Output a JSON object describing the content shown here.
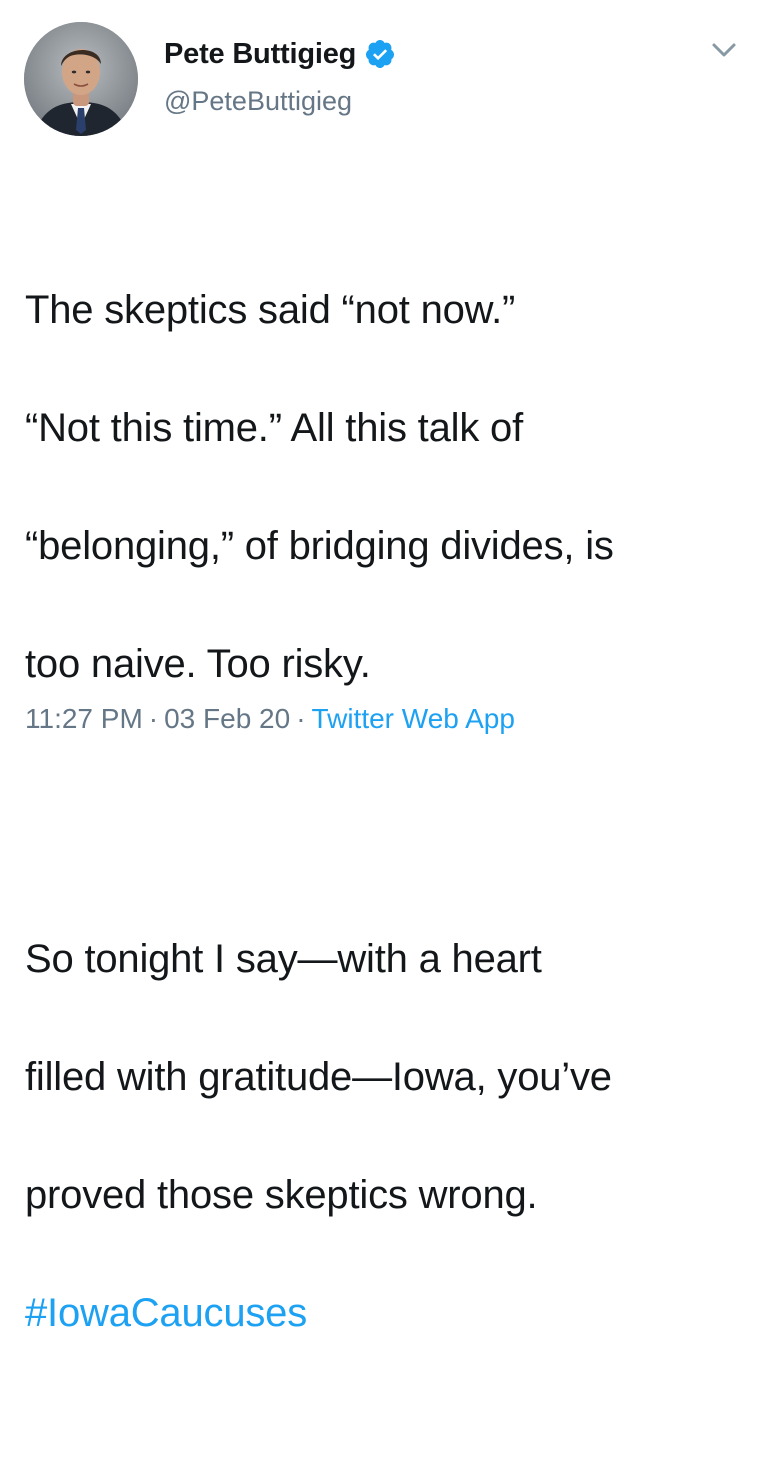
{
  "user": {
    "display_name": "Pete Buttigieg",
    "handle": "@PeteButtigieg",
    "verified": true,
    "avatar_icon": "profile-photo",
    "more_icon": "chevron-down-icon"
  },
  "tweet": {
    "paragraph1": [
      "The skeptics said “not now.”",
      "“Not this time.” All this talk of",
      "“belonging,” of bridging divides, is",
      "too naive. Too risky."
    ],
    "paragraph2": [
      "So tonight I say—with a heart",
      "filled with gratitude—Iowa, you’ve",
      "proved those skeptics wrong."
    ],
    "hashtag": "#IowaCaucuses"
  },
  "meta": {
    "time": "11:27 PM",
    "separator": "·",
    "date": "03 Feb 20",
    "source": "Twitter Web App"
  },
  "colors": {
    "link": "#1da1f2",
    "muted": "#657786",
    "text": "#14171a"
  }
}
